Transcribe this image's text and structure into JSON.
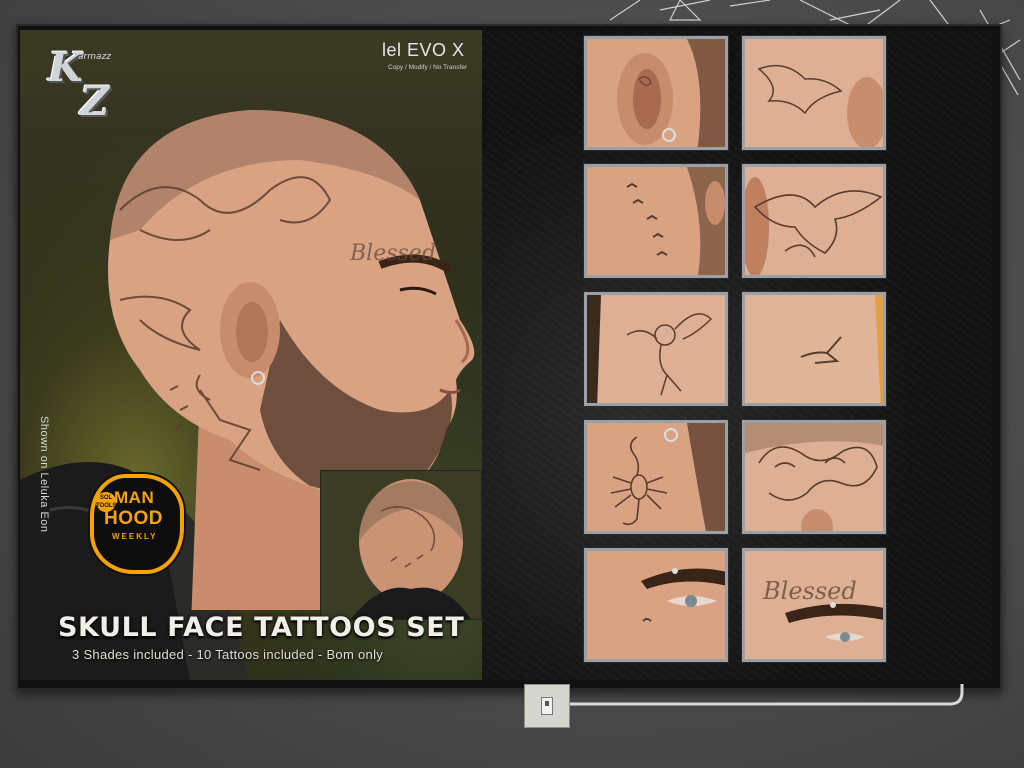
{
  "brand": {
    "logo_letters_top": "K",
    "logo_letters_bottom": "Z",
    "logo_small": "armazz",
    "logo_icon": "karmazz-logo"
  },
  "poster": {
    "body_label": "lel EVO X",
    "permissions": "Copy / Modify / No Transfer",
    "shown_on": "Shown on Leluka Eon",
    "title": "SKULL FACE TATTOOS SET",
    "subtitle": "3 Shades included - 10 Tattoos included - Bom only",
    "event_badge": {
      "sol": "SOL\nTOOLS",
      "line1": "MAN",
      "line2": "HOOD",
      "line3": "WEEKLY",
      "accent": "#f5a300"
    }
  },
  "thumbnails": [
    {
      "name": "ear-tattoo"
    },
    {
      "name": "bird-behind-ear"
    },
    {
      "name": "birds-neck"
    },
    {
      "name": "eagle-back-head"
    },
    {
      "name": "cherub-neck"
    },
    {
      "name": "small-bird-nape"
    },
    {
      "name": "scorpion-neck"
    },
    {
      "name": "dragon-head"
    },
    {
      "name": "eye-small-mark"
    },
    {
      "name": "blessed-brow",
      "text": "Blessed"
    }
  ],
  "tattoo_text": "Blessed",
  "colors": {
    "background": "#4a4a4a",
    "frame": "#111111",
    "thumb_border": "#9aa0a6",
    "skin": "#d9a283"
  }
}
